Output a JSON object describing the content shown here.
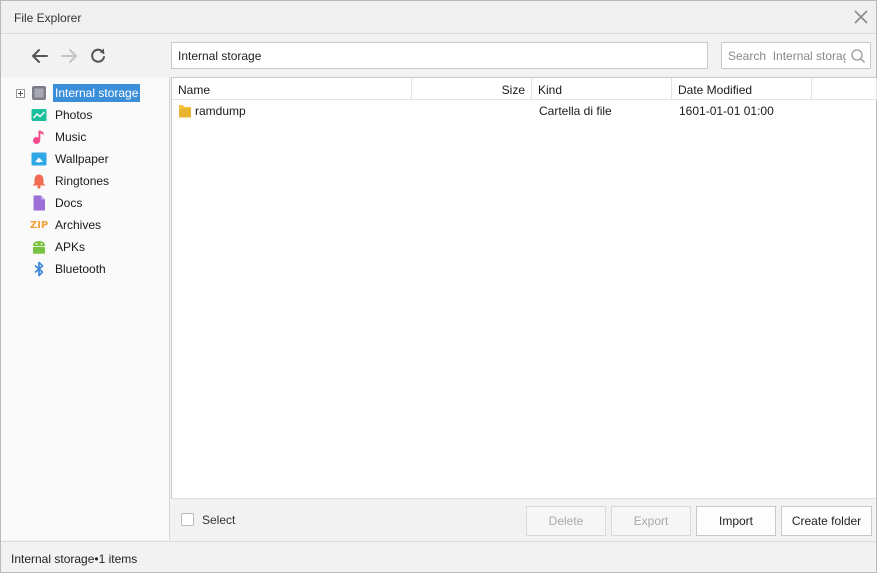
{
  "window": {
    "title": "File Explorer"
  },
  "toolbar": {
    "address": "Internal storage",
    "search_placeholder": "Search  Internal storag"
  },
  "sidebar": {
    "items": [
      {
        "label": "Internal storage",
        "icon": "internal-storage-icon",
        "selected": true
      },
      {
        "label": "Photos",
        "icon": "photos-icon",
        "color": "#1cbf9c"
      },
      {
        "label": "Music",
        "icon": "music-icon",
        "color": "#f24a8c"
      },
      {
        "label": "Wallpaper",
        "icon": "wallpaper-icon",
        "color": "#2ea8e6"
      },
      {
        "label": "Ringtones",
        "icon": "ringtones-icon",
        "color": "#f26a4f"
      },
      {
        "label": "Docs",
        "icon": "docs-icon",
        "color": "#9b6fd6"
      },
      {
        "label": "Archives",
        "icon": "archives-icon",
        "icon_text": "ZIP",
        "color": "#f2a23a"
      },
      {
        "label": "APKs",
        "icon": "apks-icon",
        "color": "#7cc242"
      },
      {
        "label": "Bluetooth",
        "icon": "bluetooth-icon",
        "color": "#3a86d6"
      }
    ]
  },
  "table": {
    "columns": [
      "Name",
      "Size",
      "Kind",
      "Date Modified"
    ],
    "rows": [
      {
        "name": "ramdump",
        "size": "",
        "kind": "Cartella di file",
        "date": "1601-01-01 01:00",
        "icon": "folder-icon"
      }
    ]
  },
  "footer": {
    "select_label": "Select",
    "delete_label": "Delete",
    "export_label": "Export",
    "import_label": "Import",
    "create_folder_label": "Create folder"
  },
  "status": {
    "text": "Internal  storage•1 items"
  },
  "colors": {
    "accent": "#3b8fd9",
    "folder": "#f5c542"
  }
}
